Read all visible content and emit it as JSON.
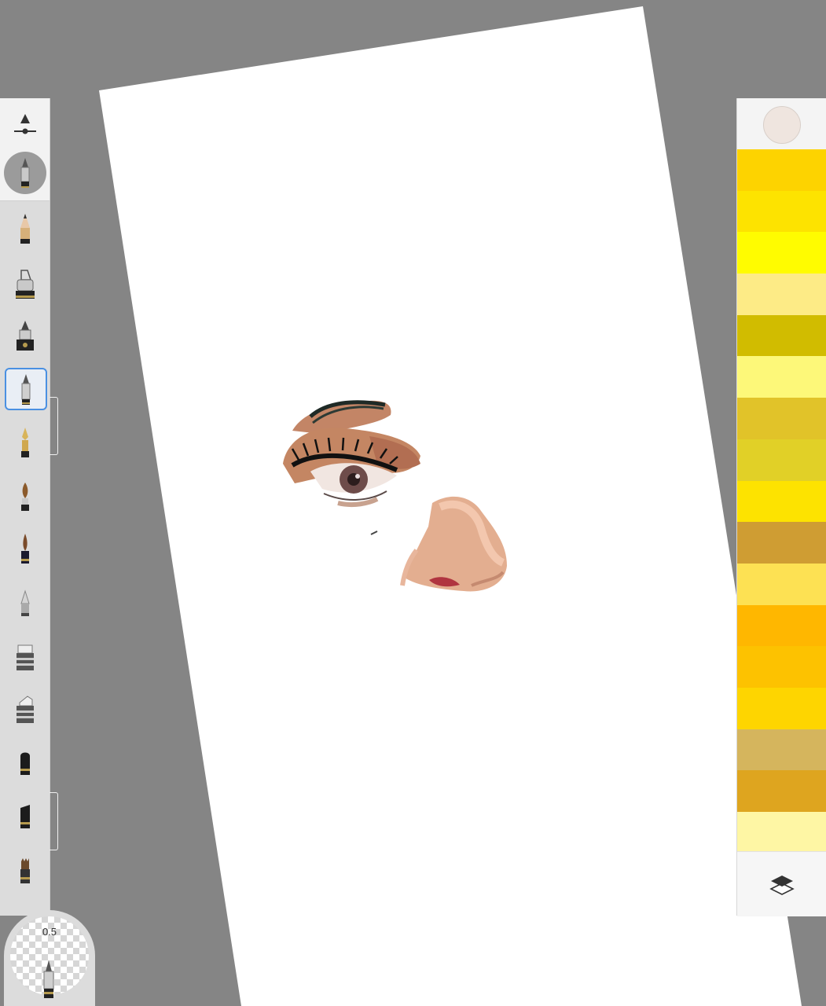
{
  "toolbar": {
    "size_slider_icon": "brush-size-slider-icon",
    "current_brush_icon": "technical-pen-icon",
    "brushes": [
      {
        "name": "pencil-icon",
        "selected": false
      },
      {
        "name": "ink-pen-icon",
        "selected": false
      },
      {
        "name": "marker-icon",
        "selected": false
      },
      {
        "name": "technical-pen-icon",
        "selected": true
      },
      {
        "name": "fountain-pen-icon",
        "selected": false
      },
      {
        "name": "paint-brush-icon",
        "selected": false
      },
      {
        "name": "watercolor-brush-icon",
        "selected": false
      },
      {
        "name": "airbrush-icon",
        "selected": false
      },
      {
        "name": "eraser-icon",
        "selected": false
      },
      {
        "name": "soft-eraser-icon",
        "selected": false
      },
      {
        "name": "smudge-icon",
        "selected": false
      },
      {
        "name": "fill-icon",
        "selected": false
      },
      {
        "name": "texture-brush-icon",
        "selected": false
      }
    ]
  },
  "puck": {
    "value": "0.5",
    "icon": "technical-pen-icon"
  },
  "color_panel": {
    "current_color": "#efe5df",
    "swatches": [
      "#fdd300",
      "#fde300",
      "#fffc00",
      "#fdeb86",
      "#d1bc00",
      "#fdf879",
      "#e1c329",
      "#e1d027",
      "#fde300",
      "#cf9d33",
      "#fde153",
      "#ffb700",
      "#fdc200",
      "#fed500",
      "#d5b55d",
      "#dea51f",
      "#fef6a4"
    ],
    "layers_icon": "layers-icon"
  },
  "canvas": {
    "background": "#858585",
    "paper_color": "#ffffff"
  }
}
